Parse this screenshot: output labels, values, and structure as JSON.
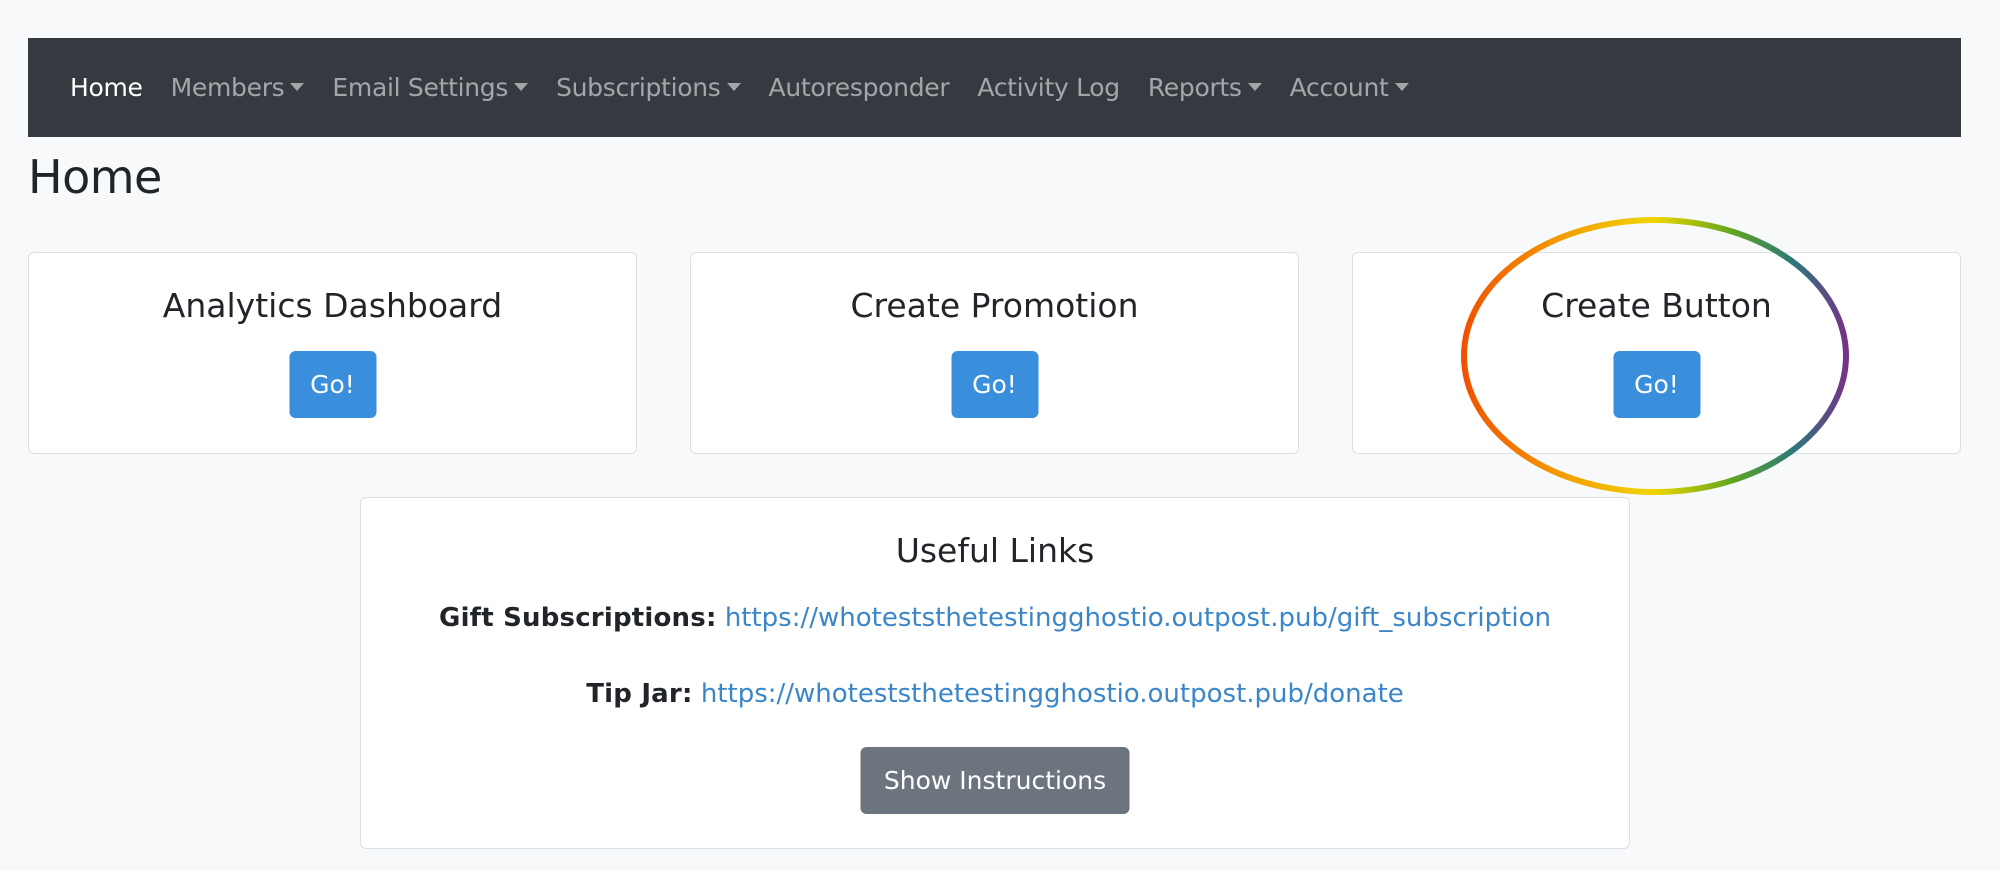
{
  "nav": {
    "items": [
      {
        "label": "Home",
        "active": true,
        "dropdown": false
      },
      {
        "label": "Members",
        "active": false,
        "dropdown": true
      },
      {
        "label": "Email Settings",
        "active": false,
        "dropdown": true
      },
      {
        "label": "Subscriptions",
        "active": false,
        "dropdown": true
      },
      {
        "label": "Autoresponder",
        "active": false,
        "dropdown": false
      },
      {
        "label": "Activity Log",
        "active": false,
        "dropdown": false
      },
      {
        "label": "Reports",
        "active": false,
        "dropdown": true
      },
      {
        "label": "Account",
        "active": false,
        "dropdown": true
      }
    ]
  },
  "page": {
    "title": "Home"
  },
  "cards": [
    {
      "title": "Analytics Dashboard",
      "button_label": "Go!"
    },
    {
      "title": "Create Promotion",
      "button_label": "Go!"
    },
    {
      "title": "Create Button",
      "button_label": "Go!"
    }
  ],
  "useful_links": {
    "title": "Useful Links",
    "links": [
      {
        "label": "Gift Subscriptions:",
        "url": "https://whoteststhetestingghostio.outpost.pub/gift_subscription"
      },
      {
        "label": "Tip Jar:",
        "url": "https://whoteststhetestingghostio.outpost.pub/donate"
      }
    ],
    "button_label": "Show Instructions"
  },
  "colors": {
    "navbar_bg": "#343a40",
    "page_bg": "#f8f9fa",
    "primary": "#3a8fdd",
    "secondary": "#6c757d",
    "link": "#3a86c9"
  },
  "annotation": {
    "type": "rainbow-ellipse",
    "target": "Create Button card"
  }
}
